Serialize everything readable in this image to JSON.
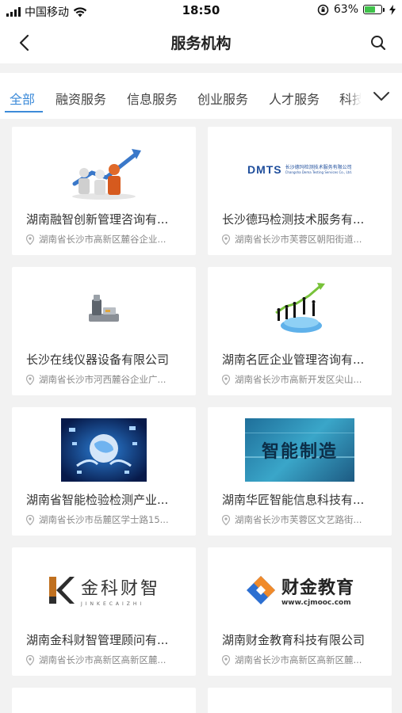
{
  "status": {
    "carrier": "中国移动",
    "time": "18:50",
    "battery": "63%",
    "battery_level": 0.63
  },
  "nav": {
    "title": "服务机构"
  },
  "tabs": [
    {
      "label": "全部",
      "active": true
    },
    {
      "label": "融资服务",
      "active": false
    },
    {
      "label": "信息服务",
      "active": false
    },
    {
      "label": "创业服务",
      "active": false
    },
    {
      "label": "人才服务",
      "active": false
    },
    {
      "label": "科技",
      "active": false
    }
  ],
  "cards": [
    {
      "name": "湖南融智创新管理咨询有...",
      "address": "湖南省长沙市高新区麓谷企业...",
      "logo": "business-people-image"
    },
    {
      "name": "长沙德玛检测技术服务有...",
      "address": "湖南省长沙市芙蓉区朝阳街道...",
      "logo": "dmts-logo",
      "logo_text": "DMTS",
      "logo_subtext": "长沙德玛检测技术服务有限公司",
      "logo_subtext2": "Changsha Dema Testing Services Co., Ltd."
    },
    {
      "name": "长沙在线仪器设备有限公司",
      "address": "湖南省长沙市河西麓谷企业广...",
      "logo": "instrument-image"
    },
    {
      "name": "湖南名匠企业管理咨询有...",
      "address": "湖南省长沙市高新开发区尖山...",
      "logo": "success-figures-image"
    },
    {
      "name": "湖南省智能检验检测产业...",
      "address": "湖南省长沙市岳麓区学士路15...",
      "logo": "globe-hands-image"
    },
    {
      "name": "湖南华匠智能信息科技有...",
      "address": "湖南省长沙市芙蓉区文艺路街...",
      "logo": "smart-manufacturing-image",
      "logo_text": "智能制造"
    },
    {
      "name": "湖南金科财智管理顾问有...",
      "address": "湖南省长沙市高新区高新区麓...",
      "logo": "jinke-logo",
      "logo_text": "金科财智",
      "logo_subtext": "JINKECAIZHI"
    },
    {
      "name": "湖南财金教育科技有限公司",
      "address": "湖南省长沙市高新区高新区麓...",
      "logo": "caijin-logo",
      "logo_text": "财金教育",
      "logo_subtext": "www.cjmooc.com"
    }
  ],
  "colors": {
    "accent": "#3d8bd9",
    "background": "#f2f2f2"
  }
}
